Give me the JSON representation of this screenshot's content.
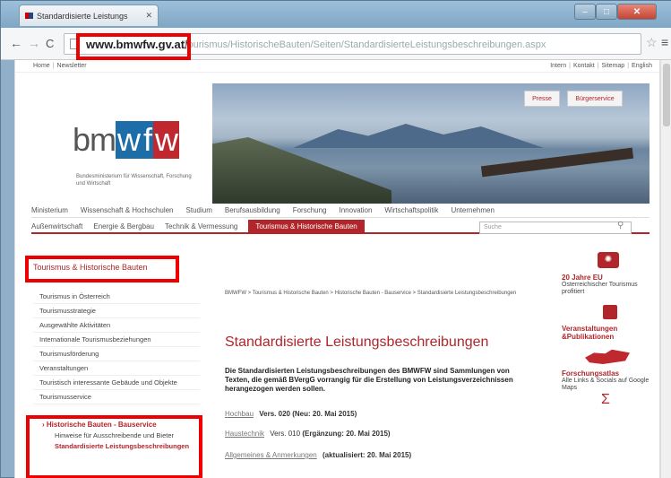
{
  "browser": {
    "tab_title": "Standardisierte Leistungs",
    "url_host": "www.bmwfw.gv.at/",
    "url_path": "Tourismus/HistorischeBauten/Seiten/StandardisierteLeistungsbeschreibungen.aspx"
  },
  "top_links": {
    "left": [
      "Home",
      "Newsletter"
    ],
    "right": [
      "Intern",
      "Kontakt",
      "Sitemap",
      "English"
    ]
  },
  "logo": {
    "b": "bm",
    "w1": "w",
    "f": "f",
    "w2": "w",
    "sub": "Bundesministerium für Wissenschaft, Forschung und Wirtschaft"
  },
  "hero_buttons": [
    "Presse",
    "Bürgerservice"
  ],
  "nav1": [
    "Ministerium",
    "Wissenschaft & Hochschulen",
    "Studium",
    "Berufsausbildung",
    "Forschung",
    "Innovation",
    "Wirtschaftspolitik",
    "Unternehmen"
  ],
  "nav2": [
    "Außenwirtschaft",
    "Energie & Bergbau",
    "Technik & Vermessung"
  ],
  "nav2_active": "Tourismus & Historische Bauten",
  "search_placeholder": "Suche",
  "sidebar": {
    "title": "Tourismus & Historische Bauten",
    "items": [
      "Tourismus in Österreich",
      "Tourismusstrategie",
      "Ausgewählte Aktivitäten",
      "Internationale Tourismusbeziehungen",
      "Tourismusförderung",
      "Veranstaltungen",
      "Touristisch interessante Gebäude und Objekte",
      "Tourismusservice"
    ],
    "active_section": "Historische Bauten - Bauservice",
    "sub_item": "Hinweise für Ausschreibende und Bieter",
    "current": "Standardisierte Leistungsbeschreibungen"
  },
  "main": {
    "breadcrumb": "BMWFW > Tourismus & Historische Bauten > Historische Bauten - Bauservice > Standardisierte Leistungsbeschreibungen",
    "title": "Standardisierte Leistungsbeschreibungen",
    "intro": "Die Standardisierten Leistungsbeschreibungen des BMWFW sind Sammlungen von Texten, die gemäß BVergG vorrangig für die Erstellung von Leistungsverzeichnissen herangezogen werden sollen.",
    "docs": [
      {
        "link": "Hochbau",
        "version": "Vers. 020",
        "note": "(Neu: 20. Mai 2015)"
      },
      {
        "link": "Haustechnik",
        "version": "Vers. 010",
        "note": "(Ergänzung: 20. Mai 2015)"
      },
      {
        "link": "Allgemeines & Anmerkungen",
        "version": "",
        "note": "(aktualisiert: 20. Mai 2015)"
      }
    ]
  },
  "rail": {
    "eu_title": "20 Jahre EU",
    "eu_text": "Österreichischer Tourismus profitiert",
    "events_title": "Veranstaltungen &Publikationen",
    "atlas_title": "Forschungsatlas",
    "atlas_text": "Alle Links & Socials auf Google Maps"
  },
  "colors": {
    "accent": "#b0262b",
    "highlight": "#ee0000"
  }
}
